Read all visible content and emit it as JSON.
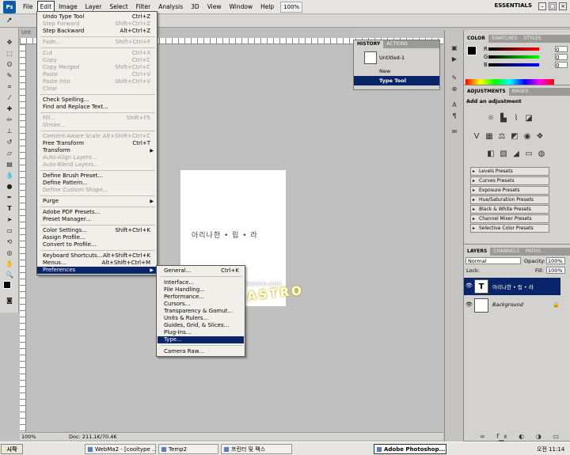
{
  "menubar": {
    "logo": "Ps",
    "items": [
      "File",
      "Edit",
      "Image",
      "Layer",
      "Select",
      "Filter",
      "Analysis",
      "3D",
      "View",
      "Window",
      "Help"
    ],
    "zoom": "100%",
    "workspace": "ESSENTIALS"
  },
  "document": {
    "tab_fragment": "Unt",
    "status_zoom": "100%",
    "status_doc": "Doc: 211.1K/70.4K",
    "canvas_text": "아리나한 • 립 • 라",
    "watermark_url": "blog.hisastro.com",
    "watermark_logo": "HI-SASTRO"
  },
  "edit_menu": [
    {
      "label": "Undo Type Tool",
      "shortcut": "Ctrl+Z",
      "disabled": false
    },
    {
      "label": "Step Forward",
      "shortcut": "Shift+Ctrl+Z",
      "disabled": true
    },
    {
      "label": "Step Backward",
      "shortcut": "Alt+Ctrl+Z",
      "disabled": false
    },
    {
      "sep": true
    },
    {
      "label": "Fade...",
      "shortcut": "Shift+Ctrl+F",
      "disabled": true
    },
    {
      "sep": true
    },
    {
      "label": "Cut",
      "shortcut": "Ctrl+X",
      "disabled": true
    },
    {
      "label": "Copy",
      "shortcut": "Ctrl+C",
      "disabled": true
    },
    {
      "label": "Copy Merged",
      "shortcut": "Shift+Ctrl+C",
      "disabled": true
    },
    {
      "label": "Paste",
      "shortcut": "Ctrl+V",
      "disabled": true
    },
    {
      "label": "Paste Into",
      "shortcut": "Shift+Ctrl+V",
      "disabled": true
    },
    {
      "label": "Clear",
      "shortcut": "",
      "disabled": true
    },
    {
      "sep": true
    },
    {
      "label": "Check Spelling...",
      "shortcut": "",
      "disabled": false
    },
    {
      "label": "Find and Replace Text...",
      "shortcut": "",
      "disabled": false
    },
    {
      "sep": true
    },
    {
      "label": "Fill...",
      "shortcut": "Shift+F5",
      "disabled": true
    },
    {
      "label": "Stroke...",
      "shortcut": "",
      "disabled": true
    },
    {
      "sep": true
    },
    {
      "label": "Content-Aware Scale",
      "shortcut": "Alt+Shift+Ctrl+C",
      "disabled": true
    },
    {
      "label": "Free Transform",
      "shortcut": "Ctrl+T",
      "disabled": false
    },
    {
      "label": "Transform",
      "shortcut": "",
      "disabled": false,
      "submenu": true
    },
    {
      "label": "Auto-Align Layers...",
      "shortcut": "",
      "disabled": true
    },
    {
      "label": "Auto-Blend Layers...",
      "shortcut": "",
      "disabled": true
    },
    {
      "sep": true
    },
    {
      "label": "Define Brush Preset...",
      "shortcut": "",
      "disabled": false
    },
    {
      "label": "Define Pattern...",
      "shortcut": "",
      "disabled": false
    },
    {
      "label": "Define Custom Shape...",
      "shortcut": "",
      "disabled": true
    },
    {
      "sep": true
    },
    {
      "label": "Purge",
      "shortcut": "",
      "disabled": false,
      "submenu": true
    },
    {
      "sep": true
    },
    {
      "label": "Adobe PDF Presets...",
      "shortcut": "",
      "disabled": false
    },
    {
      "label": "Preset Manager...",
      "shortcut": "",
      "disabled": false
    },
    {
      "sep": true
    },
    {
      "label": "Color Settings...",
      "shortcut": "Shift+Ctrl+K",
      "disabled": false
    },
    {
      "label": "Assign Profile...",
      "shortcut": "",
      "disabled": false
    },
    {
      "label": "Convert to Profile...",
      "shortcut": "",
      "disabled": false
    },
    {
      "sep": true
    },
    {
      "label": "Keyboard Shortcuts...",
      "shortcut": "Alt+Shift+Ctrl+K",
      "disabled": false
    },
    {
      "label": "Menus...",
      "shortcut": "Alt+Shift+Ctrl+M",
      "disabled": false
    },
    {
      "label": "Preferences",
      "shortcut": "",
      "disabled": false,
      "submenu": true,
      "highlight": true
    }
  ],
  "prefs_menu": [
    {
      "label": "General...",
      "shortcut": "Ctrl+K"
    },
    {
      "sep": true
    },
    {
      "label": "Interface..."
    },
    {
      "label": "File Handling..."
    },
    {
      "label": "Performance..."
    },
    {
      "label": "Cursors..."
    },
    {
      "label": "Transparency & Gamut..."
    },
    {
      "label": "Units & Rulers..."
    },
    {
      "label": "Guides, Grid, & Slices..."
    },
    {
      "label": "Plug-Ins..."
    },
    {
      "label": "Type...",
      "highlight": true
    },
    {
      "sep": true
    },
    {
      "label": "Camera Raw..."
    }
  ],
  "history": {
    "tabs": [
      "HISTORY",
      "ACTIONS"
    ],
    "snapshot": "Untitled-1",
    "rows": [
      "New",
      "Type Tool"
    ]
  },
  "color_panel": {
    "tabs": [
      "COLOR",
      "SWATCHES",
      "STYLES"
    ],
    "channels": [
      {
        "label": "R",
        "value": "0"
      },
      {
        "label": "G",
        "value": "0"
      },
      {
        "label": "B",
        "value": "0"
      }
    ]
  },
  "adjustments": {
    "tabs": [
      "ADJUSTMENTS",
      "MASKS"
    ],
    "heading": "Add an adjustment",
    "presets": [
      "Levels Presets",
      "Curves Presets",
      "Exposure Presets",
      "Hue/Saturation Presets",
      "Black & White Presets",
      "Channel Mixer Presets",
      "Selective Color Presets"
    ]
  },
  "layers": {
    "tabs": [
      "LAYERS",
      "CHANNELS",
      "PATHS"
    ],
    "blend_mode": "Normal",
    "opacity_label": "Opacity:",
    "opacity": "100%",
    "lock_label": "Lock:",
    "fill_label": "Fill:",
    "fill": "100%",
    "items": [
      {
        "name": "아리나한 • 립 • 라",
        "type": "T"
      },
      {
        "name": "Background",
        "type": ""
      }
    ]
  },
  "taskbar": {
    "start": "시작",
    "buttons": [
      "WebMa2 - [cooltype ...",
      "Temp2",
      "프린터 및 팩스",
      "Adobe Photoshop..."
    ],
    "time": "오전 11:14"
  }
}
